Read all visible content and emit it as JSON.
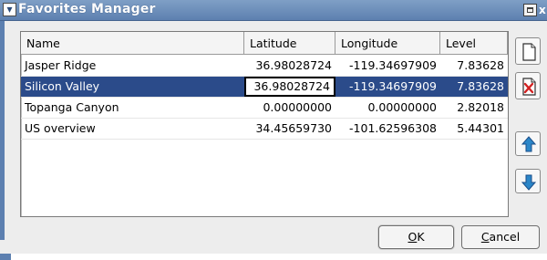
{
  "window": {
    "title": "Favorites Manager",
    "menu_icon": "chevron-down-icon",
    "close_glyph": "x"
  },
  "table": {
    "columns": [
      "Name",
      "Latitude",
      "Longitude",
      "Level"
    ],
    "rows": [
      {
        "name": "Jasper Ridge",
        "latitude": "36.98028724",
        "longitude": "-119.34697909",
        "level": "7.83628"
      },
      {
        "name": "Silicon Valley",
        "latitude": "36.98028724",
        "longitude": "-119.34697909",
        "level": "7.83628"
      },
      {
        "name": "Topanga Canyon",
        "latitude": "0.00000000",
        "longitude": "0.00000000",
        "level": "2.82018"
      },
      {
        "name": "US overview",
        "latitude": "34.45659730",
        "longitude": "-101.62596308",
        "level": "5.44301"
      }
    ],
    "selected_row": 1,
    "editing_column": "latitude"
  },
  "side_buttons": {
    "new": "new-document-icon",
    "delete": "delete-document-icon",
    "up": "arrow-up-icon",
    "down": "arrow-down-icon"
  },
  "dialog": {
    "ok_label": "OK",
    "cancel_label": "Cancel"
  },
  "colors": {
    "title_bar": "#6a8bba",
    "selection": "#2b4b8a",
    "arrow_accent": "#2b86c8",
    "delete_accent": "#d22222"
  }
}
